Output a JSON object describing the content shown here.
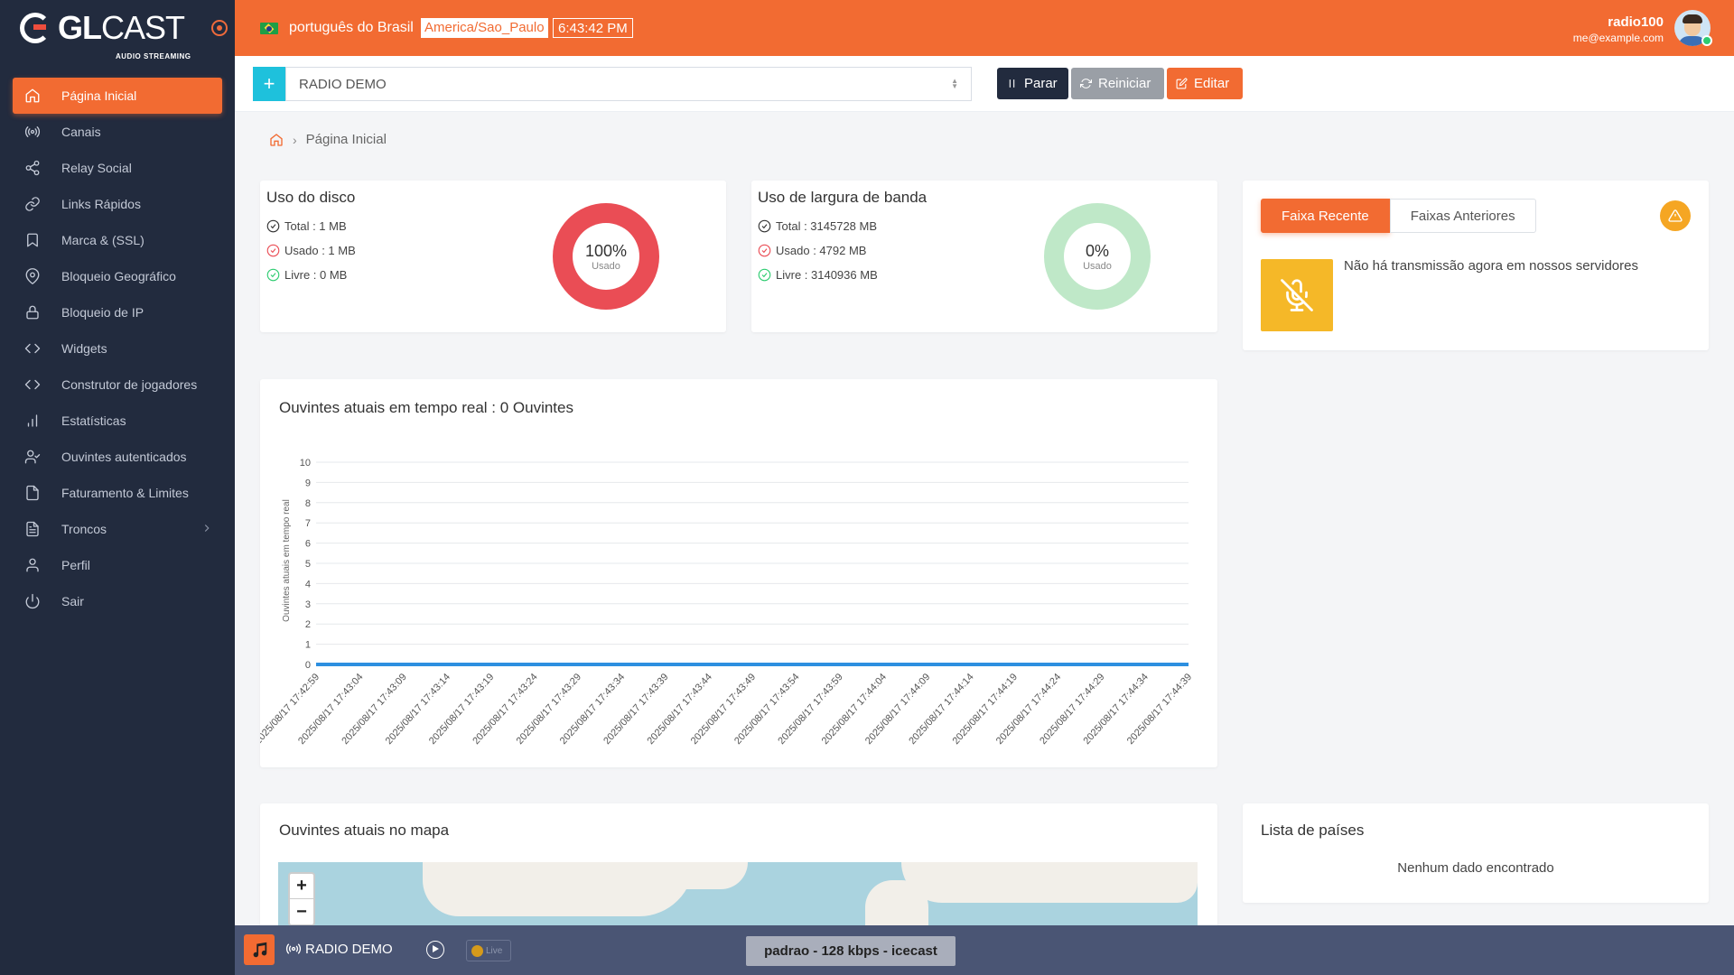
{
  "brand": {
    "logo_bold": "GL",
    "logo_thin": "CAST",
    "subtitle": "AUDIO STREAMING"
  },
  "sidebar": {
    "items": [
      {
        "label": "Página Inicial",
        "icon": "home-icon",
        "active": true
      },
      {
        "label": "Canais",
        "icon": "broadcast-icon"
      },
      {
        "label": "Relay Social",
        "icon": "share-icon"
      },
      {
        "label": "Links Rápidos",
        "icon": "link-icon"
      },
      {
        "label": "Marca & (SSL)",
        "icon": "bookmark-icon"
      },
      {
        "label": "Bloqueio Geográfico",
        "icon": "map-pin-icon"
      },
      {
        "label": "Bloqueio de IP",
        "icon": "lock-icon"
      },
      {
        "label": "Widgets",
        "icon": "code-icon"
      },
      {
        "label": "Construtor de jogadores",
        "icon": "code-icon"
      },
      {
        "label": "Estatísticas",
        "icon": "bar-chart-icon"
      },
      {
        "label": "Ouvintes autenticados",
        "icon": "user-check-icon"
      },
      {
        "label": "Faturamento & Limites",
        "icon": "file-icon"
      },
      {
        "label": "Troncos",
        "icon": "file-text-icon",
        "has_children": true
      },
      {
        "label": "Perfil",
        "icon": "user-icon"
      },
      {
        "label": "Sair",
        "icon": "power-icon"
      }
    ]
  },
  "header": {
    "language": "português do Brasil",
    "timezone": "America/Sao_Paulo",
    "time": "6:43:42 PM",
    "user_name": "radio100",
    "user_email": "me@example.com",
    "accent": "#f26b32"
  },
  "toolbar": {
    "add_label": "+",
    "station_select": "RADIO DEMO",
    "stop_label": "Parar",
    "restart_label": "Reiniciar",
    "edit_label": "Editar"
  },
  "breadcrumb": {
    "current": "Página Inicial"
  },
  "disk": {
    "title": "Uso do disco",
    "total": "Total : 1 MB",
    "used": "Usado : 1 MB",
    "free": "Livre : 0 MB",
    "percent_label": "100%",
    "percent": 100,
    "donut_label": "Usado",
    "color": "#ea4d55"
  },
  "bandwidth": {
    "title": "Uso de largura de banda",
    "total": "Total : 3145728 MB",
    "used": "Usado : 4792 MB",
    "free": "Livre : 3140936 MB",
    "percent_label": "0%",
    "percent": 0,
    "donut_label": "Usado",
    "color": "#bfe8c8"
  },
  "tracks": {
    "tab_recent": "Faixa Recente",
    "tab_previous": "Faixas Anteriores",
    "message": "Não há transmissão agora em nossos servidores"
  },
  "chart_data": {
    "type": "line",
    "title": "Ouvintes atuais em tempo real : 0 Ouvintes",
    "ylabel": "Ouvintes atuais em tempo real",
    "xlabel": "",
    "ylim": [
      0,
      10
    ],
    "yticks": [
      0,
      1,
      2,
      3,
      4,
      5,
      6,
      7,
      8,
      9,
      10
    ],
    "grid": true,
    "x": [
      "2025/08/17 17:42:59",
      "2025/08/17 17:43:04",
      "2025/08/17 17:43:09",
      "2025/08/17 17:43:14",
      "2025/08/17 17:43:19",
      "2025/08/17 17:43:24",
      "2025/08/17 17:43:29",
      "2025/08/17 17:43:34",
      "2025/08/17 17:43:39",
      "2025/08/17 17:43:44",
      "2025/08/17 17:43:49",
      "2025/08/17 17:43:54",
      "2025/08/17 17:43:59",
      "2025/08/17 17:44:04",
      "2025/08/17 17:44:09",
      "2025/08/17 17:44:14",
      "2025/08/17 17:44:19",
      "2025/08/17 17:44:24",
      "2025/08/17 17:44:29",
      "2025/08/17 17:44:34",
      "2025/08/17 17:44:39"
    ],
    "series": [
      {
        "values": [
          0,
          0,
          0,
          0,
          0,
          0,
          0,
          0,
          0,
          0,
          0,
          0,
          0,
          0,
          0,
          0,
          0,
          0,
          0,
          0,
          0
        ],
        "color": "#2d8fe0"
      }
    ]
  },
  "map": {
    "title": "Ouvintes atuais no mapa",
    "zoom_in": "+",
    "zoom_out": "−"
  },
  "countries": {
    "title": "Lista de países",
    "empty": "Nenhum dado encontrado"
  },
  "player": {
    "station": "RADIO DEMO",
    "live_label": "Live",
    "stream_info": "padrao - 128 kbps - icecast"
  }
}
